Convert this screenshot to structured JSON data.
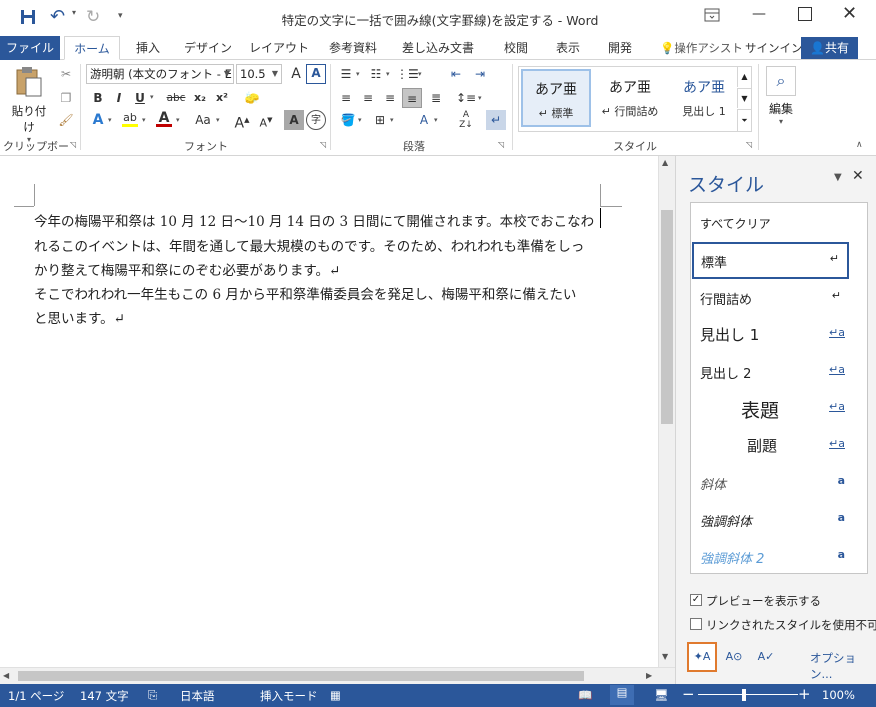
{
  "window": {
    "title": "特定の文字に一括で囲み線(文字罫線)を設定する - Word",
    "qat": {
      "save_icon": "save-icon",
      "undo_icon": "undo-icon",
      "redo_icon": "redo-icon",
      "customize_icon": "customize-icon"
    },
    "controls": {
      "ribbon_options_icon": "ribbon-display-options-icon",
      "minimize_icon": "minimize-icon",
      "maximize_icon": "maximize-icon",
      "close_icon": "close-icon"
    }
  },
  "tabs": {
    "items": [
      "ファイル",
      "ホーム",
      "挿入",
      "デザイン",
      "レイアウト",
      "参考資料",
      "差し込み文書",
      "校閲",
      "表示",
      "開発"
    ],
    "tell_me": "操作アシスト",
    "signin": "サインイン",
    "share": "共有"
  },
  "ribbon": {
    "clipboard": {
      "paste_label": "貼り付け",
      "group_label": "クリップボード"
    },
    "font": {
      "font_name": "游明朝 (本文のフォント - E",
      "font_size": "10.5",
      "group_label": "フォント",
      "buttons": [
        "B",
        "I",
        "U",
        "abc",
        "x₂",
        "x²"
      ],
      "grow": "A",
      "shrink": "A",
      "case": "Aa",
      "clear": "A",
      "enclose": "字"
    },
    "paragraph": {
      "group_label": "段落"
    },
    "styles": {
      "group_label": "スタイル",
      "items": [
        {
          "sample": "あア亜",
          "name": "↵ 標準"
        },
        {
          "sample": "あア亜",
          "name": "↵ 行間詰め"
        },
        {
          "sample": "あア亜",
          "name": "見出し 1"
        }
      ]
    },
    "editing": {
      "label": "編集"
    }
  },
  "document": {
    "lines": [
      "今年の梅陽平和祭は 10 月 12 日～10 月 14 日の 3 日間にて開催されます。本校でおこなわ",
      "れるこのイベントは、年間を通して最大規模のものです。そのため、われわれも準備をしっ",
      "かり整えて梅陽平和祭にのぞむ必要があります。↵",
      "そこでわれわれ一年生もこの 6 月から平和祭準備委員会を発足し、梅陽平和祭に備えたい",
      "と思います。↵"
    ]
  },
  "styles_pane": {
    "title": "スタイル",
    "items": [
      {
        "name": "すべてクリア",
        "icon": ""
      },
      {
        "name": "標準",
        "icon": "↵"
      },
      {
        "name": "行間詰め",
        "icon": "↵"
      },
      {
        "name": "見出し 1",
        "icon": "↵a"
      },
      {
        "name": "見出し 2",
        "icon": "↵a"
      },
      {
        "name": "表題",
        "icon": "↵a"
      },
      {
        "name": "副題",
        "icon": "↵a"
      },
      {
        "name": "斜体",
        "icon": "a"
      },
      {
        "name": "強調斜体",
        "icon": "a"
      },
      {
        "name": "強調斜体 2",
        "icon": "a"
      }
    ],
    "preview_label": "プレビューを表示する",
    "preview_checked": true,
    "linked_label": "リンクされたスタイルを使用不可にす",
    "linked_checked": false,
    "options_link": "オプション..."
  },
  "status": {
    "page": "1/1 ページ",
    "words": "147 文字",
    "language": "日本語",
    "mode": "挿入モード",
    "zoom": "100%",
    "zoom_level": 100
  },
  "colors": {
    "accent": "#2b579a",
    "highlight": "#e07a2e",
    "font_color": "#c00000",
    "highlight_yellow": "#ffff00"
  }
}
